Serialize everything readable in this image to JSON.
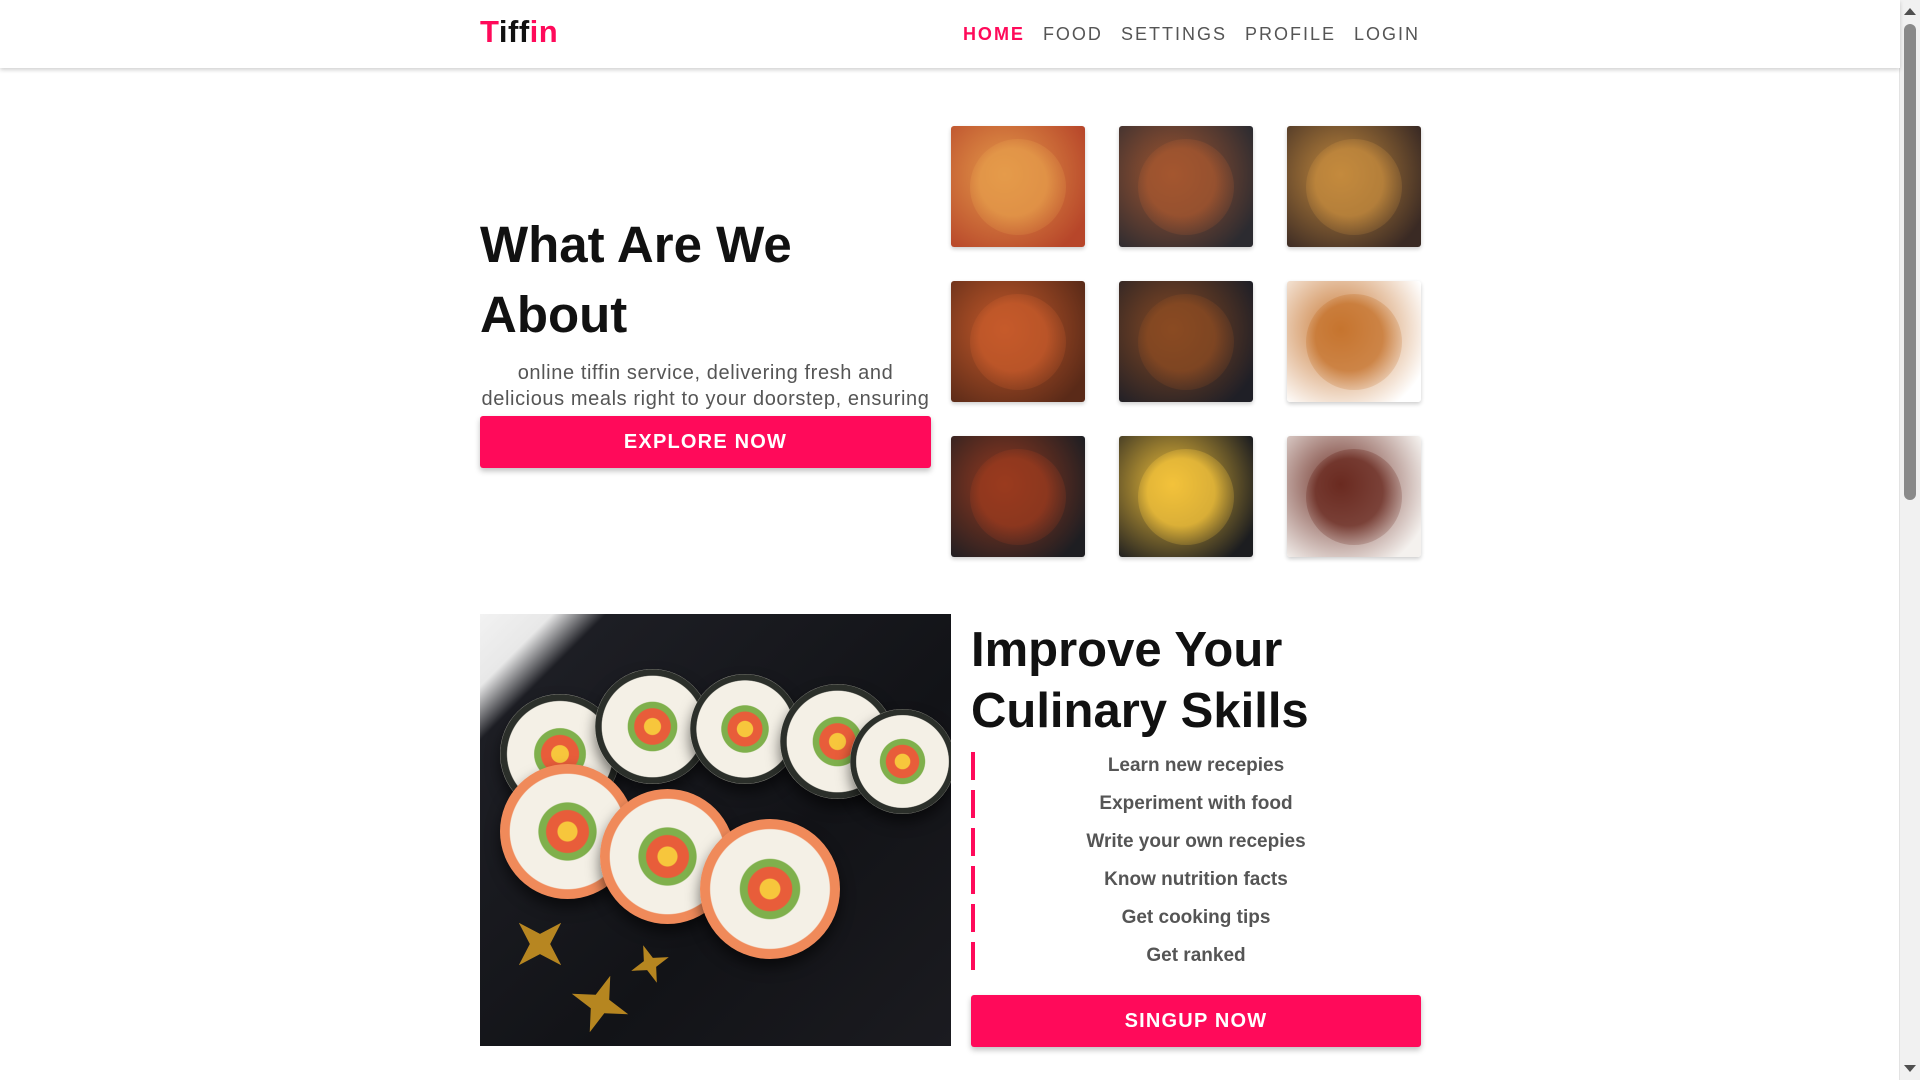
{
  "nav": {
    "brand_parts": [
      "T",
      "iff",
      "in"
    ],
    "links": [
      "HOME",
      "FOOD",
      "SETTINGS",
      "PROFILE",
      "LOGIN"
    ],
    "active": "HOME"
  },
  "about": {
    "title": "What Are We About",
    "description": "online tiffin service, delivering fresh and delicious meals right to your doorstep, ensuring convenience and quality with every bite.",
    "button": "EXPLORE NOW"
  },
  "food_images": [
    {
      "icon": "pizza-image",
      "colors": [
        "#b7462a",
        "#e59b4a"
      ]
    },
    {
      "icon": "rice-bowls-image",
      "colors": [
        "#2c2b30",
        "#a4562f"
      ]
    },
    {
      "icon": "dishes-spread-image",
      "colors": [
        "#3a2a24",
        "#c48a3d"
      ]
    },
    {
      "icon": "spaghetti-image",
      "colors": [
        "#5a2a18",
        "#c65a2a"
      ]
    },
    {
      "icon": "burger-image",
      "colors": [
        "#1f1f26",
        "#8a4a22"
      ]
    },
    {
      "icon": "biryani-image",
      "colors": [
        "#ffffff",
        "#c6742e"
      ]
    },
    {
      "icon": "grilled-chicken-image",
      "colors": [
        "#1e1e22",
        "#9a3a1e"
      ]
    },
    {
      "icon": "bibimbap-image",
      "colors": [
        "#1c1d20",
        "#f3c23a"
      ]
    },
    {
      "icon": "steak-image",
      "colors": [
        "#f4f1ee",
        "#6a2a20"
      ]
    }
  ],
  "skills": {
    "title": "Improve Your Culinary Skills",
    "items": [
      "Learn new recepies",
      "Experiment with food",
      "Write your own recepies",
      "Know nutrition facts",
      "Get cooking tips",
      "Get ranked"
    ],
    "button": "SINGUP NOW"
  },
  "colors": {
    "accent": "#ff0a5a",
    "text": "#111111",
    "muted": "#555555"
  }
}
